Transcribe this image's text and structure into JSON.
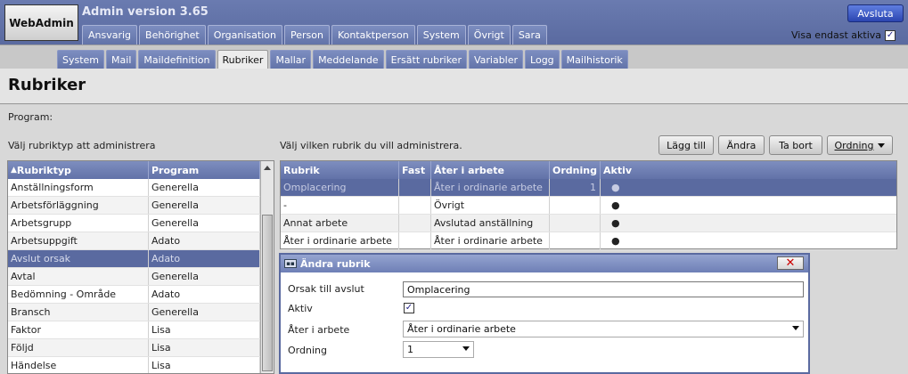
{
  "app": {
    "logo": "WebAdmin",
    "version": "Admin version 3.65",
    "logout_label": "Avsluta"
  },
  "main_tabs": [
    "Ansvarig",
    "Behörighet",
    "Organisation",
    "Person",
    "Kontaktperson",
    "System",
    "Övrigt",
    "Sara"
  ],
  "visa_aktiva": {
    "label": "Visa endast aktiva",
    "checked": true,
    "mark": "✓"
  },
  "sub_tabs": [
    "System",
    "Mail",
    "Maildefinition",
    "Rubriker",
    "Mallar",
    "Meddelande",
    "Ersätt rubriker",
    "Variabler",
    "Logg",
    "Mailhistorik"
  ],
  "active_sub_tab": "Rubriker",
  "page_title": "Rubriker",
  "program_label": "Program:",
  "left_instruction": "Välj rubriktyp att administrera",
  "right_instruction": "Välj vilken rubrik du vill administrera.",
  "buttons": {
    "add": "Lägg till",
    "edit": "Ändra",
    "delete": "Ta bort",
    "order": "Ordning"
  },
  "left_table": {
    "headers": [
      "Rubriktyp",
      "Program"
    ],
    "sort_arrow": "▲",
    "rows": [
      [
        "Anställningsform",
        "Generella"
      ],
      [
        "Arbetsförläggning",
        "Generella"
      ],
      [
        "Arbetsgrupp",
        "Generella"
      ],
      [
        "Arbetsuppgift",
        "Adato"
      ],
      [
        "Avslut orsak",
        "Adato"
      ],
      [
        "Avtal",
        "Generella"
      ],
      [
        "Bedömning - Område",
        "Adato"
      ],
      [
        "Bransch",
        "Generella"
      ],
      [
        "Faktor",
        "Lisa"
      ],
      [
        "Följd",
        "Lisa"
      ],
      [
        "Händelse",
        "Lisa"
      ]
    ],
    "selected_index": 4
  },
  "right_table": {
    "headers": [
      "Rubrik",
      "Fast",
      "Åter i arbete",
      "Ordning",
      "Aktiv"
    ],
    "rows": [
      [
        "Omplacering",
        "",
        "Åter i ordinarie arbete",
        "1",
        "●"
      ],
      [
        "-",
        "",
        "Övrigt",
        "",
        "●"
      ],
      [
        "Annat arbete",
        "",
        "Avslutad anställning",
        "",
        "●"
      ],
      [
        "Åter i ordinarie arbete",
        "",
        "Åter i ordinarie arbete",
        "",
        "●"
      ]
    ],
    "selected_index": 0
  },
  "dialog": {
    "title": "Ändra rubrik",
    "close": "✕",
    "fields": {
      "orsak_label": "Orsak till avslut",
      "orsak_value": "Omplacering",
      "aktiv_label": "Aktiv",
      "aktiv_mark": "✓",
      "ater_label": "Åter i arbete",
      "ater_value": "Åter i ordinarie arbete",
      "ordning_label": "Ordning",
      "ordning_value": "1"
    }
  }
}
